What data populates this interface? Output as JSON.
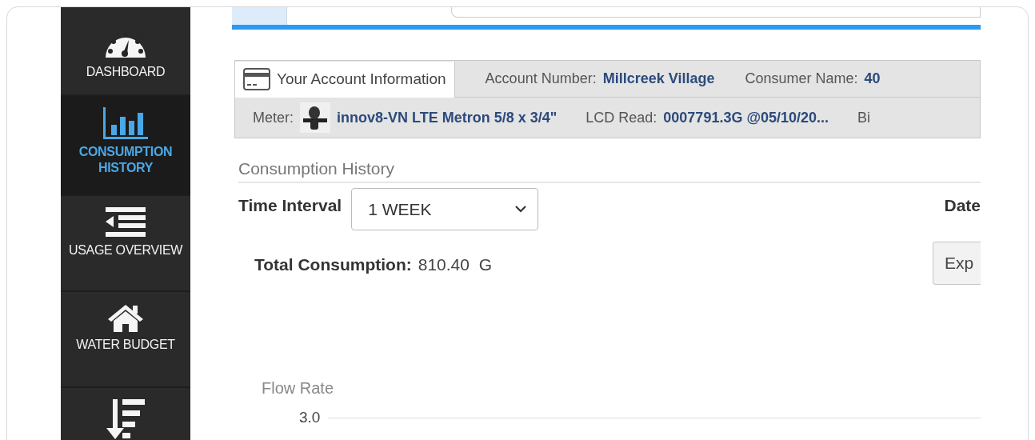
{
  "sidebar": {
    "items": [
      {
        "label": "DASHBOARD",
        "selected": false
      },
      {
        "label": "CONSUMPTION HISTORY",
        "selected": true
      },
      {
        "label": "USAGE OVERVIEW",
        "selected": false
      },
      {
        "label": "WATER BUDGET",
        "selected": false
      },
      {
        "selected": false
      }
    ]
  },
  "account_panel": {
    "tab": "Your Account Information",
    "row_1": [
      {
        "label": "Account Number:",
        "value": "Millcreek Village"
      },
      {
        "label": "Consumer Name:",
        "value": "40"
      }
    ],
    "row_2": [
      {
        "label": "Meter:",
        "value": "innov8-VN LTE Metron 5/8 x 3/4\"",
        "kind": "meter"
      },
      {
        "label": "LCD Read:",
        "value": "0007791.3G @05/10/20...",
        "kind": "text"
      },
      {
        "label": "Bi",
        "kind": "text"
      }
    ]
  },
  "consumption_history": {
    "title": "Consumption History",
    "time_interval": {
      "label": "Time Interval",
      "value": "1 WEEK"
    },
    "date_label": "Date",
    "total": {
      "label": "Total Consumption:",
      "value": "810.40  G"
    },
    "export_button": "Exp",
    "chart": {
      "ylabel": "Flow Rate",
      "top_tick": "3.0"
    }
  }
}
